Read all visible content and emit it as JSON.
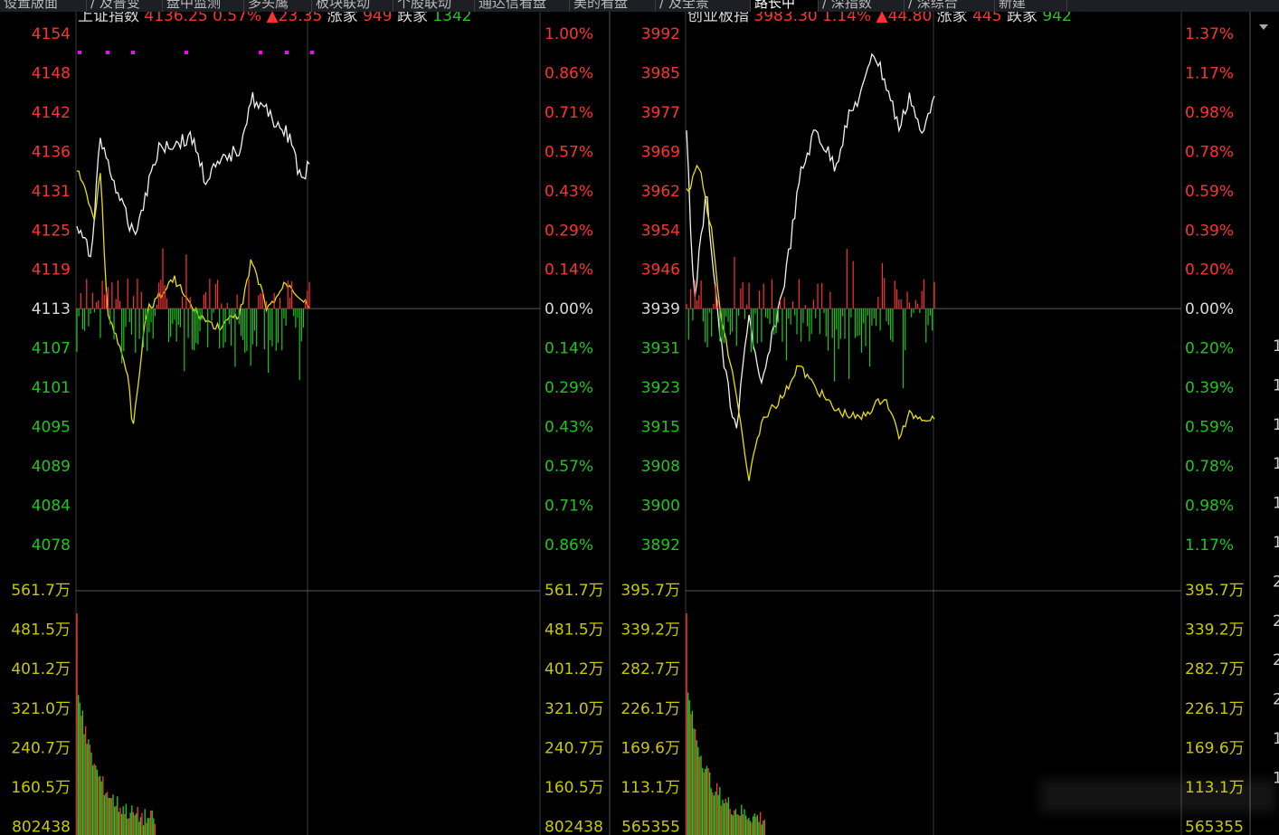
{
  "tabs": [
    {
      "label": "设置版面",
      "active": false
    },
    {
      "label": "/ 及普变",
      "active": false
    },
    {
      "label": "盘中监测",
      "active": false
    },
    {
      "label": "多头鹰",
      "active": false
    },
    {
      "label": "板块联动",
      "active": false
    },
    {
      "label": "个股联动",
      "active": false
    },
    {
      "label": "通达信看盘",
      "active": false
    },
    {
      "label": "美的看盘",
      "active": false
    },
    {
      "label": "/ 及全景",
      "active": false
    },
    {
      "label": "路长中",
      "active": true
    },
    {
      "label": "/ 深指数",
      "active": false
    },
    {
      "label": "/ 深综合",
      "active": false
    },
    {
      "label": "新建",
      "active": false
    }
  ],
  "colors": {
    "up": "#ff3232",
    "down": "#22c322",
    "neutral": "#d8d8d8",
    "price_line": "#f2f2f2",
    "avg_line": "#e8e000",
    "volume_axis": "#c8c800",
    "grid": "#3c3c3c",
    "marker": "#ff00ff"
  },
  "panels": [
    {
      "name": "上证指数",
      "price": "4136.25",
      "pct": "0.57%",
      "change": "▲23.35",
      "up_label": "涨家",
      "up_count": "949",
      "down_label": "跌家",
      "down_count": "1342",
      "left_labels": [
        "4154",
        "4148",
        "4142",
        "4136",
        "4131",
        "4125",
        "4119",
        "4113",
        "4107",
        "4101",
        "4095",
        "4089",
        "4084",
        "4078"
      ],
      "right_labels": [
        "1.00%",
        "0.86%",
        "0.71%",
        "0.57%",
        "0.43%",
        "0.29%",
        "0.14%",
        "0.00%",
        "0.14%",
        "0.29%",
        "0.43%",
        "0.57%",
        "0.71%",
        "0.86%"
      ],
      "volume_labels": [
        "561.7万",
        "481.5万",
        "401.2万",
        "321.0万",
        "240.7万",
        "160.5万",
        "802438"
      ]
    },
    {
      "name": "创业板指",
      "price": "3983.30",
      "pct": "1.14%",
      "change": "▲44.80",
      "up_label": "涨家",
      "up_count": "445",
      "down_label": "跌家",
      "down_count": "942",
      "left_labels": [
        "3992",
        "3985",
        "3977",
        "3969",
        "3962",
        "3954",
        "3946",
        "3939",
        "3931",
        "3923",
        "3915",
        "3908",
        "3900",
        "3892"
      ],
      "right_labels": [
        "1.37%",
        "1.17%",
        "0.98%",
        "0.78%",
        "0.59%",
        "0.39%",
        "0.20%",
        "0.00%",
        "0.20%",
        "0.39%",
        "0.59%",
        "0.78%",
        "0.98%",
        "1.17%"
      ],
      "volume_labels": [
        "395.7万",
        "339.2万",
        "282.7万",
        "226.1万",
        "169.6万",
        "113.1万",
        "565355"
      ]
    }
  ],
  "edge_digits": [
    "1",
    "1",
    "1",
    "1",
    "1",
    "1",
    "2",
    "2",
    "2",
    "2",
    "1",
    "1"
  ]
}
